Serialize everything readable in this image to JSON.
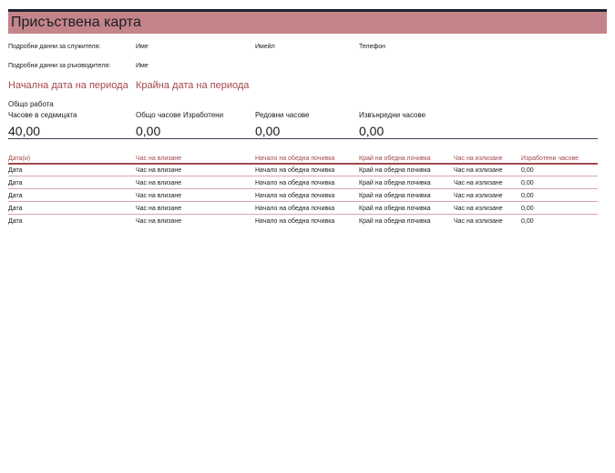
{
  "title": "Присъствена карта",
  "employee": {
    "label": "Подробни данни за служителя:",
    "name_label": "Име",
    "email_label": "Имейл",
    "phone_label": "Телефон"
  },
  "manager": {
    "label": "Подробни данни за ръководителя:",
    "name_label": "Име"
  },
  "period": {
    "start_label": "Начална дата на периода",
    "end_label": "Крайна дата на периода"
  },
  "summary": {
    "section_label": "Общо работа",
    "items": [
      {
        "label": "Часове в седмицата",
        "value": "40,00"
      },
      {
        "label": "Общо часове Изработени",
        "value": "0,00"
      },
      {
        "label": "Редовни часове",
        "value": "0,00"
      },
      {
        "label": "Извънредни часове",
        "value": "0,00"
      }
    ]
  },
  "table": {
    "headers": [
      "Дата(и)",
      "Час на влизане",
      "Начало на обедна почивка",
      "Край на обедна почивка",
      "Час на излизане",
      "Изработени часове"
    ],
    "rows": [
      [
        "Дата",
        "Час на влизане",
        "Начало на обедна почивка",
        "Край на обедна почивка",
        "Час на излизане",
        "0,00"
      ],
      [
        "Дата",
        "Час на влизане",
        "Начало на обедна почивка",
        "Край на обедна почивка",
        "Час на излизане",
        "0,00"
      ],
      [
        "Дата",
        "Час на влизане",
        "Начало на обедна почивка",
        "Край на обедна почивка",
        "Час на излизане",
        "0,00"
      ],
      [
        "Дата",
        "Час на влизане",
        "Начало на обедна почивка",
        "Край на обедна почивка",
        "Час на излизане",
        "0,00"
      ],
      [
        "Дата",
        "Час на влизане",
        "Начало на обедна почивка",
        "Край на обедна почивка",
        "Час на излизане",
        "0,00"
      ]
    ]
  },
  "colors": {
    "accent": "#a3474c",
    "title_bar": "#c4858a",
    "rule": "#1f2233"
  }
}
